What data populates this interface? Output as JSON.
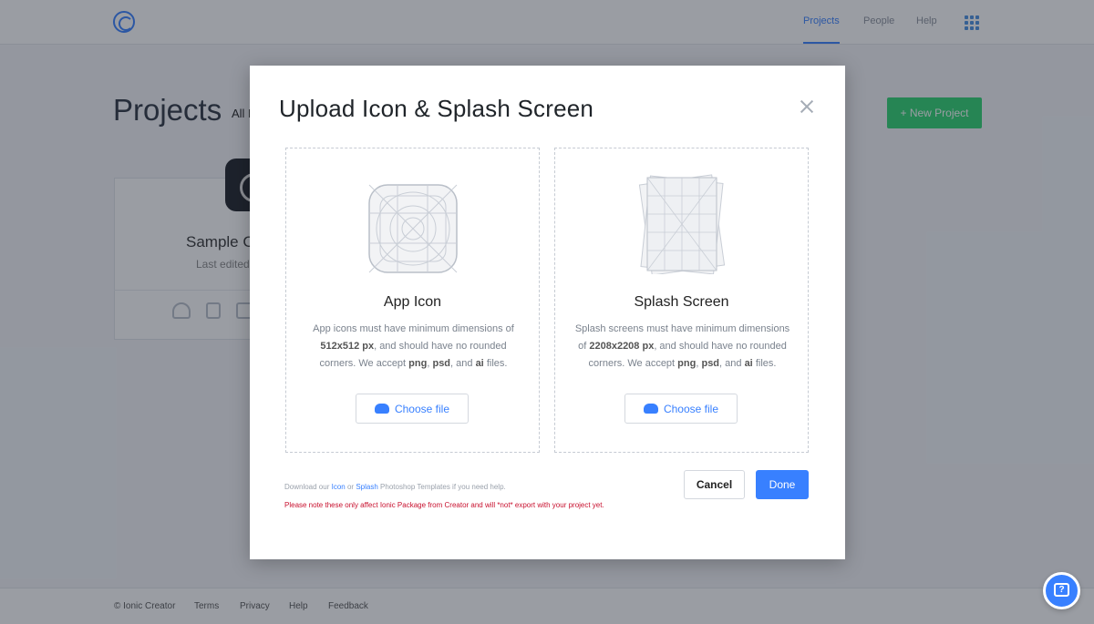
{
  "nav": {
    "logo_icon": "ionic-logo-icon",
    "items": [
      {
        "label": "Projects",
        "active": true
      },
      {
        "label": "People",
        "active": false
      },
      {
        "label": "Help",
        "active": false
      }
    ],
    "apps_icon": "grid-icon"
  },
  "page": {
    "title": "Projects",
    "filter_label": "All P",
    "new_project_label": "+ New Project",
    "card": {
      "name": "Sample C",
      "edited": "Last edited"
    }
  },
  "modal": {
    "title": "Upload Icon & Splash Screen",
    "app_icon": {
      "heading": "App Icon",
      "desc_1": "App icons must have minimum dimensions of",
      "dims": "512x512 px",
      "desc_2": ", and should have no rounded",
      "desc_3": "corners. We accept",
      "fmt_1": "png",
      "fmt_2": "psd",
      "fmt_3": "ai",
      "desc_4": "files.",
      "button": "Choose file"
    },
    "splash": {
      "heading": "Splash Screen",
      "desc_1": "Splash screens must have minimum dimensions",
      "desc_of": "of",
      "dims": "2208x2208 px",
      "desc_2": ", and should have no rounded",
      "desc_3": "corners. We accept",
      "fmt_1": "png",
      "fmt_2": "psd",
      "fmt_3": "ai",
      "desc_4": "files.",
      "button": "Choose file"
    },
    "help_pre": "Download our",
    "help_icon_link": "Icon",
    "help_or": "or",
    "help_splash_link": "Splash",
    "help_post": "Photoshop Templates if you need help.",
    "note": "Please note these only affect Ionic Package from Creator and will *not* export with your project yet.",
    "cancel": "Cancel",
    "done": "Done"
  },
  "footer": {
    "copyright": "© Ionic Creator",
    "links": [
      "Terms",
      "Privacy",
      "Help",
      "Feedback"
    ]
  }
}
